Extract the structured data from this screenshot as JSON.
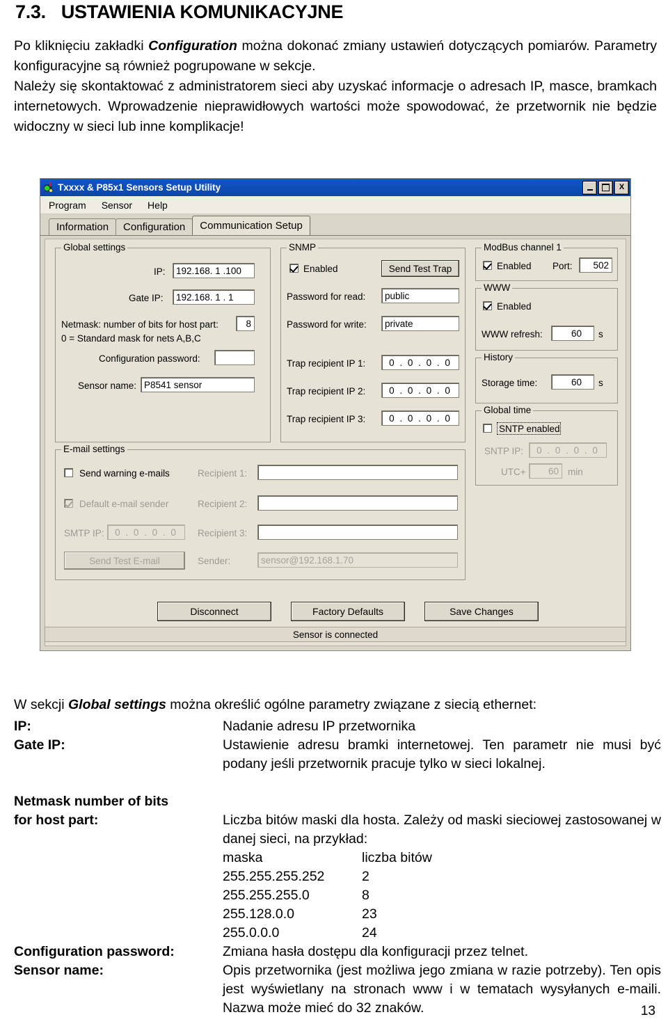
{
  "document": {
    "heading_number": "7.3.",
    "heading_text": "USTAWIENIA KOMUNIKACYJNE",
    "paragraph1": "Po kliknięciu zakładki Configuration można dokonać zmiany ustawień dotyczących pomiarów. Parametry konfiguracyjne są również pogrupowane w sekcje.",
    "paragraph1_pre": "Po kliknięciu zakładki ",
    "paragraph1_bold": "Configuration",
    "paragraph1_post": " można dokonać zmiany ustawień dotyczących pomiarów. Parametry konfiguracyjne są również pogrupowane w sekcje.",
    "paragraph2": "Należy się skontaktować z administratorem sieci aby uzyskać informacje o adresach IP, masce, bramkach internetowych. Wprowadzenie nieprawidłowych wartości może spowodować, że przetwornik nie będzie widoczny w sieci lub inne komplikacje!",
    "page_number": "13"
  },
  "screenshot": {
    "window": {
      "title": "Txxxx & P85x1 Sensors Setup Utility",
      "icon": "sensor-app-icon",
      "minimize_label": "_",
      "maximize_label": "□",
      "close_label": "X"
    },
    "menu": [
      "Program",
      "Sensor",
      "Help"
    ],
    "tabs": [
      {
        "label": "Information",
        "active": false
      },
      {
        "label": "Configuration",
        "active": false
      },
      {
        "label": "Communication Setup",
        "active": true
      }
    ],
    "global_settings": {
      "caption": "Global settings",
      "ip_label": "IP:",
      "ip_value": "192.168.  1 .100",
      "gate_ip_label": "Gate IP:",
      "gate_ip_value": "192.168.  1 .  1",
      "netmask_label": "Netmask: number of bits for host part:",
      "netmask_value": "8",
      "netmask_note": "0 = Standard mask for nets A,B,C",
      "config_password_label": "Configuration password:",
      "config_password_value": "",
      "sensor_name_label": "Sensor name:",
      "sensor_name_value": "P8541 sensor"
    },
    "snmp": {
      "caption": "SNMP",
      "enabled_label": "Enabled",
      "enabled_checked": true,
      "send_test_trap_label": "Send Test Trap",
      "password_read_label": "Password for read:",
      "password_read_value": "public",
      "password_write_label": "Password for write:",
      "password_write_value": "private",
      "trap1_label": "Trap recipient IP 1:",
      "trap1_value": "0 . 0 . 0 . 0",
      "trap2_label": "Trap recipient IP 2:",
      "trap2_value": "0 . 0 . 0 . 0",
      "trap3_label": "Trap recipient IP 3:",
      "trap3_value": "0 . 0 . 0 . 0"
    },
    "modbus": {
      "caption": "ModBus channel 1",
      "enabled_label": "Enabled",
      "enabled_checked": true,
      "port_label": "Port:",
      "port_value": "502"
    },
    "www": {
      "caption": "WWW",
      "enabled_label": "Enabled",
      "enabled_checked": true,
      "refresh_label": "WWW refresh:",
      "refresh_value": "60",
      "refresh_unit": "s"
    },
    "history": {
      "caption": "History",
      "storage_time_label": "Storage time:",
      "storage_time_value": "60",
      "storage_time_unit": "s"
    },
    "global_time": {
      "caption": "Global time",
      "sntp_enabled_label": "SNTP enabled",
      "sntp_enabled_checked": false,
      "sntp_ip_label": "SNTP IP:",
      "sntp_ip_value": "0 . 0 . 0 . 0",
      "utc_label": "UTC+",
      "utc_value": "60",
      "utc_unit": "min"
    },
    "email": {
      "caption": "E-mail settings",
      "send_warning_label": "Send warning e-mails",
      "send_warning_checked": false,
      "default_sender_label": "Default e-mail sender",
      "default_sender_checked": true,
      "smtp_ip_label": "SMTP IP:",
      "smtp_ip_value": "0 . 0 . 0 . 0",
      "send_test_email_label": "Send Test E-mail",
      "recipient1_label": "Recipient 1:",
      "recipient1_value": "",
      "recipient2_label": "Recipient 2:",
      "recipient2_value": "",
      "recipient3_label": "Recipient 3:",
      "recipient3_value": "",
      "sender_label": "Sender:",
      "sender_value": "sensor@192.168.1.70"
    },
    "buttons": {
      "disconnect": "Disconnect",
      "factory_defaults": "Factory Defaults",
      "save_changes": "Save Changes"
    },
    "status": "Sensor is connected"
  },
  "definitions": {
    "lead_pre": "W sekcji ",
    "lead_bold": "Global settings",
    "lead_post": " można określić ogólne parametry związane z siecią ethernet:",
    "ip_term": "IP:",
    "ip_def": "Nadanie adresu IP przetwornika",
    "gate_term": "Gate IP:",
    "gate_def": "Ustawienie adresu bramki internetowej. Ten parametr nie musi być podany jeśli przetwornik pracuje tylko w sieci lokalnej.",
    "netmask_term_line1": "Netmask number of bits",
    "netmask_term_line2": "for host part:",
    "netmask_def": "Liczba bitów maski dla hosta. Zależy od maski sieciowej zastosowanej w danej sieci, na przykład:",
    "mask_header_col1": "maska",
    "mask_header_col2": "liczba bitów",
    "mask_rows": [
      {
        "mask": "255.255.255.252",
        "bits": "2"
      },
      {
        "mask": "255.255.255.0",
        "bits": "8"
      },
      {
        "mask": "255.128.0.0",
        "bits": "23"
      },
      {
        "mask": "255.0.0.0",
        "bits": "24"
      }
    ],
    "cfgpass_term": "Configuration password:",
    "cfgpass_def": "Zmiana hasła dostępu dla konfiguracji przez telnet.",
    "sensorname_term": "Sensor name:",
    "sensorname_def": "Opis przetwornika (jest możliwa jego zmiana w razie potrzeby). Ten opis jest wyświetlany na stronach www i w tematach wysyłanych e-maili. Nazwa może mieć do 32 znaków."
  }
}
